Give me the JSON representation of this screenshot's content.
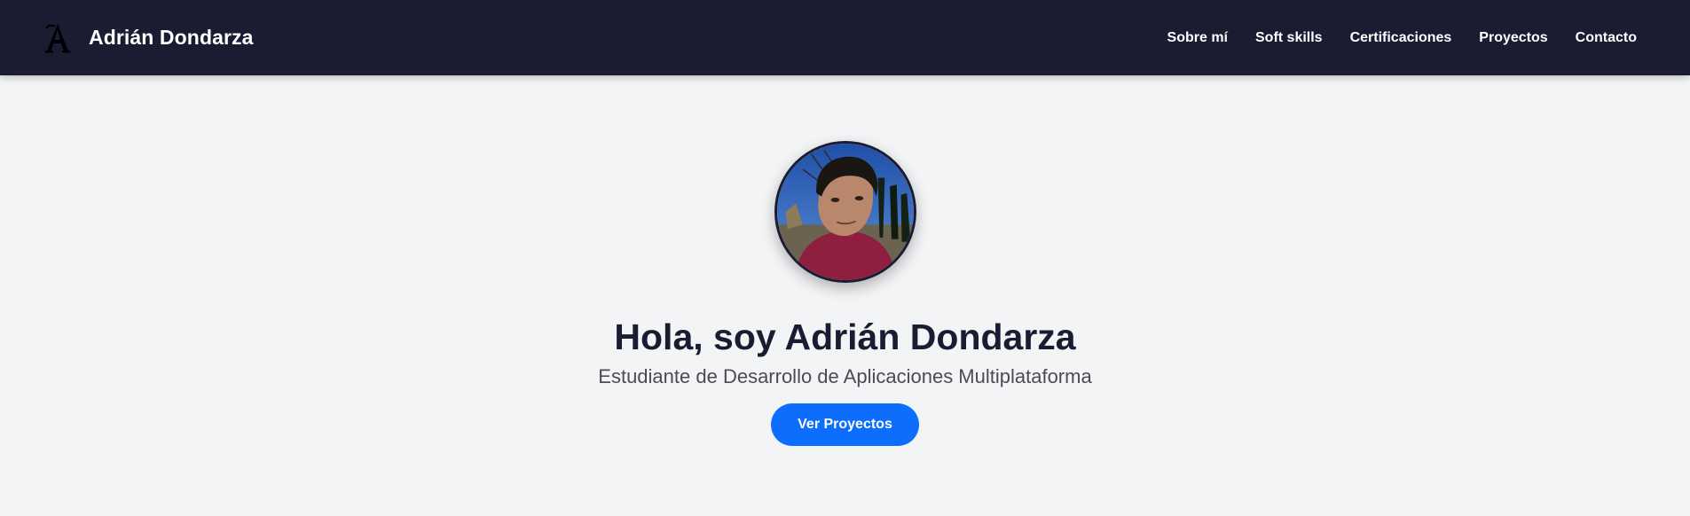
{
  "header": {
    "logo_letter": "A",
    "brand_name": "Adrián Dondarza",
    "nav": [
      {
        "label": "Sobre mí"
      },
      {
        "label": "Soft skills"
      },
      {
        "label": "Certificaciones"
      },
      {
        "label": "Proyectos"
      },
      {
        "label": "Contacto"
      }
    ]
  },
  "hero": {
    "title": "Hola, soy Adrián Dondarza",
    "subtitle": "Estudiante de Desarrollo de Aplicaciones Multiplataforma",
    "cta_label": "Ver Proyectos"
  },
  "colors": {
    "navbar_bg": "#1b1b32",
    "page_bg": "#f3f4f6",
    "accent": "#0d6efd"
  }
}
